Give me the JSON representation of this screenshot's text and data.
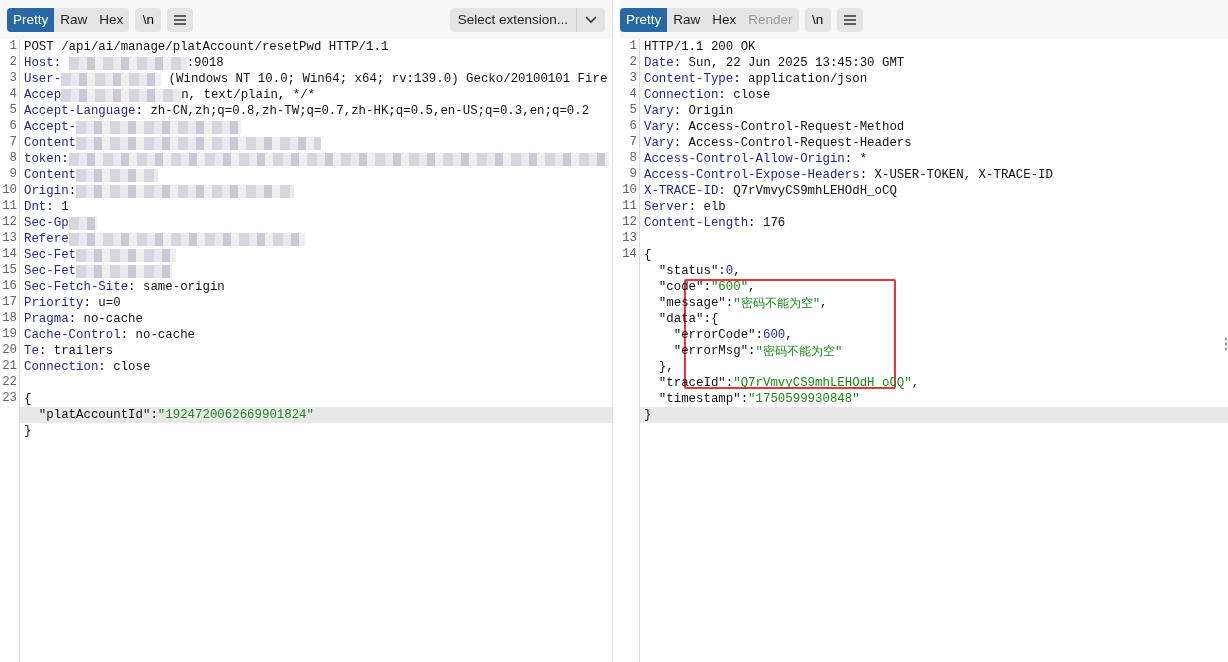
{
  "request": {
    "tabs": [
      {
        "label": "Pretty",
        "selected": true,
        "disabled": false
      },
      {
        "label": "Raw",
        "selected": false,
        "disabled": false
      },
      {
        "label": "Hex",
        "selected": false,
        "disabled": false
      }
    ],
    "newline_button": "\\n",
    "extension_select": {
      "placeholder": "Select extension..."
    },
    "lines": [
      {
        "number": "1",
        "highlighted": false,
        "parts": [
          {
            "kind": "plain",
            "text": "POST /api/ai/manage/platAccount/resetPwd HTTP/1.1"
          }
        ]
      },
      {
        "number": "2",
        "highlighted": false,
        "parts": [
          {
            "kind": "key",
            "text": "Host"
          },
          {
            "kind": "plain",
            "text": ": "
          },
          {
            "kind": "redacted"
          },
          {
            "kind": "plain",
            "text": ":9018"
          }
        ]
      },
      {
        "number": "3",
        "highlighted": false,
        "parts": [
          {
            "kind": "key",
            "text": "User-"
          },
          {
            "kind": "redacted"
          },
          {
            "kind": "plain",
            "text": " (Windows NT 10.0; Win64; x64; rv:139.0) Gecko/20100101 Fire"
          }
        ]
      },
      {
        "number": "4",
        "highlighted": false,
        "parts": [
          {
            "kind": "key",
            "text": "Accep"
          },
          {
            "kind": "redacted"
          },
          {
            "kind": "plain",
            "text": "n, text/plain, */*"
          }
        ]
      },
      {
        "number": "5",
        "highlighted": false,
        "parts": [
          {
            "kind": "key",
            "text": "Accept-Language"
          },
          {
            "kind": "plain",
            "text": ": zh-CN,zh;q=0.8,zh-TW;q=0.7,zh-HK;q=0.5,en-US;q=0.3,en;q=0.2"
          }
        ]
      },
      {
        "number": "6",
        "highlighted": false,
        "parts": [
          {
            "kind": "key",
            "text": "Accept-"
          },
          {
            "kind": "redacted"
          }
        ]
      },
      {
        "number": "7",
        "highlighted": false,
        "parts": [
          {
            "kind": "key",
            "text": "Content"
          },
          {
            "kind": "redacted"
          }
        ]
      },
      {
        "number": "8",
        "highlighted": false,
        "parts": [
          {
            "kind": "key",
            "text": "token"
          },
          {
            "kind": "plain",
            "text": ":"
          },
          {
            "kind": "redacted"
          }
        ]
      },
      {
        "number": "9",
        "highlighted": false,
        "parts": [
          {
            "kind": "key",
            "text": "Content"
          },
          {
            "kind": "redacted"
          }
        ]
      },
      {
        "number": "10",
        "highlighted": false,
        "parts": [
          {
            "kind": "key",
            "text": "Origin"
          },
          {
            "kind": "plain",
            "text": ":"
          },
          {
            "kind": "redacted"
          }
        ]
      },
      {
        "number": "11",
        "highlighted": false,
        "parts": [
          {
            "kind": "key",
            "text": "Dnt"
          },
          {
            "kind": "plain",
            "text": ": 1"
          }
        ]
      },
      {
        "number": "12",
        "highlighted": false,
        "parts": [
          {
            "kind": "key",
            "text": "Sec-Gp"
          },
          {
            "kind": "redacted"
          }
        ]
      },
      {
        "number": "13",
        "highlighted": false,
        "parts": [
          {
            "kind": "key",
            "text": "Refere"
          },
          {
            "kind": "redacted"
          }
        ]
      },
      {
        "number": "14",
        "highlighted": false,
        "parts": [
          {
            "kind": "key",
            "text": "Sec-Fet"
          },
          {
            "kind": "redacted"
          }
        ]
      },
      {
        "number": "15",
        "highlighted": false,
        "parts": [
          {
            "kind": "key",
            "text": "Sec-Fet"
          },
          {
            "kind": "redacted"
          }
        ]
      },
      {
        "number": "16",
        "highlighted": false,
        "parts": [
          {
            "kind": "key",
            "text": "Sec-Fetch-Site"
          },
          {
            "kind": "plain",
            "text": ": same-origin"
          }
        ]
      },
      {
        "number": "17",
        "highlighted": false,
        "parts": [
          {
            "kind": "key",
            "text": "Priority"
          },
          {
            "kind": "plain",
            "text": ": u=0"
          }
        ]
      },
      {
        "number": "18",
        "highlighted": false,
        "parts": [
          {
            "kind": "key",
            "text": "Pragma"
          },
          {
            "kind": "plain",
            "text": ": no-cache"
          }
        ]
      },
      {
        "number": "19",
        "highlighted": false,
        "parts": [
          {
            "kind": "key",
            "text": "Cache-Control"
          },
          {
            "kind": "plain",
            "text": ": no-cache"
          }
        ]
      },
      {
        "number": "20",
        "highlighted": false,
        "parts": [
          {
            "kind": "key",
            "text": "Te"
          },
          {
            "kind": "plain",
            "text": ": trailers"
          }
        ]
      },
      {
        "number": "21",
        "highlighted": false,
        "parts": [
          {
            "kind": "key",
            "text": "Connection"
          },
          {
            "kind": "plain",
            "text": ": close"
          }
        ]
      },
      {
        "number": "22",
        "highlighted": false
      },
      {
        "number": "23",
        "highlighted": false,
        "parts": [
          {
            "kind": "plain",
            "text": "{"
          }
        ]
      },
      {
        "highlighted": true,
        "parts": [
          {
            "kind": "plain",
            "text": "  \"platAccountId\":"
          },
          {
            "kind": "string",
            "text": "\"1924720062669901824\""
          }
        ]
      },
      {
        "highlighted": false,
        "parts": [
          {
            "kind": "plain",
            "text": "}"
          }
        ]
      }
    ]
  },
  "response": {
    "tabs": [
      {
        "label": "Pretty",
        "selected": true,
        "disabled": false
      },
      {
        "label": "Raw",
        "selected": false,
        "disabled": false
      },
      {
        "label": "Hex",
        "selected": false,
        "disabled": false
      },
      {
        "label": "Render",
        "selected": false,
        "disabled": true
      }
    ],
    "newline_button": "\\n",
    "lines": [
      {
        "number": "1",
        "highlighted": false,
        "parts": [
          {
            "kind": "plain",
            "text": "HTTP/1.1 200 OK"
          }
        ]
      },
      {
        "number": "2",
        "highlighted": false,
        "parts": [
          {
            "kind": "key",
            "text": "Date"
          },
          {
            "kind": "plain",
            "text": ": Sun, 22 Jun 2025 13:45:30 GMT"
          }
        ]
      },
      {
        "number": "3",
        "highlighted": false,
        "parts": [
          {
            "kind": "key",
            "text": "Content-Type"
          },
          {
            "kind": "plain",
            "text": ": application/json"
          }
        ]
      },
      {
        "number": "4",
        "highlighted": false,
        "parts": [
          {
            "kind": "key",
            "text": "Connection"
          },
          {
            "kind": "plain",
            "text": ": close"
          }
        ]
      },
      {
        "number": "5",
        "highlighted": false,
        "parts": [
          {
            "kind": "key",
            "text": "Vary"
          },
          {
            "kind": "plain",
            "text": ": Origin"
          }
        ]
      },
      {
        "number": "6",
        "highlighted": false,
        "parts": [
          {
            "kind": "key",
            "text": "Vary"
          },
          {
            "kind": "plain",
            "text": ": Access-Control-Request-Method"
          }
        ]
      },
      {
        "number": "7",
        "highlighted": false,
        "parts": [
          {
            "kind": "key",
            "text": "Vary"
          },
          {
            "kind": "plain",
            "text": ": Access-Control-Request-Headers"
          }
        ]
      },
      {
        "number": "8",
        "highlighted": false,
        "parts": [
          {
            "kind": "key",
            "text": "Access-Control-Allow-Origin"
          },
          {
            "kind": "plain",
            "text": ": *"
          }
        ]
      },
      {
        "number": "9",
        "highlighted": false,
        "parts": [
          {
            "kind": "key",
            "text": "Access-Control-Expose-Headers"
          },
          {
            "kind": "plain",
            "text": ": X-USER-TOKEN, X-TRACE-ID"
          }
        ]
      },
      {
        "number": "10",
        "highlighted": false,
        "parts": [
          {
            "kind": "key",
            "text": "X-TRACE-ID"
          },
          {
            "kind": "plain",
            "text": ": Q7rVmvyCS9mhLEHOdH_oCQ"
          }
        ]
      },
      {
        "number": "11",
        "highlighted": false,
        "parts": [
          {
            "kind": "key",
            "text": "Server"
          },
          {
            "kind": "plain",
            "text": ": elb"
          }
        ]
      },
      {
        "number": "12",
        "highlighted": false,
        "parts": [
          {
            "kind": "key",
            "text": "Content-Length"
          },
          {
            "kind": "plain",
            "text": ": 176"
          }
        ]
      },
      {
        "number": "13",
        "highlighted": false
      },
      {
        "number": "14",
        "highlighted": false,
        "parts": [
          {
            "kind": "plain",
            "text": "{"
          }
        ]
      },
      {
        "highlighted": false,
        "parts": [
          {
            "kind": "plain",
            "text": "  \"status\":"
          },
          {
            "kind": "number",
            "text": "0"
          },
          {
            "kind": "plain",
            "text": ","
          }
        ]
      },
      {
        "highlighted": false,
        "parts": [
          {
            "kind": "plain",
            "text": "  \"code\":"
          },
          {
            "kind": "string",
            "text": "\"600\""
          },
          {
            "kind": "plain",
            "text": ","
          }
        ]
      },
      {
        "highlighted": false,
        "parts": [
          {
            "kind": "plain",
            "text": "  \"message\":"
          },
          {
            "kind": "string",
            "text": "\"密码不能为空\""
          },
          {
            "kind": "plain",
            "text": ","
          }
        ]
      },
      {
        "highlighted": false,
        "parts": [
          {
            "kind": "plain",
            "text": "  \"data\":{"
          }
        ]
      },
      {
        "highlighted": false,
        "parts": [
          {
            "kind": "plain",
            "text": "    \"errorCode\":"
          },
          {
            "kind": "number",
            "text": "600"
          },
          {
            "kind": "plain",
            "text": ","
          }
        ]
      },
      {
        "highlighted": false,
        "parts": [
          {
            "kind": "plain",
            "text": "    \"errorMsg\":"
          },
          {
            "kind": "string",
            "text": "\"密码不能为空\""
          }
        ]
      },
      {
        "highlighted": false,
        "parts": [
          {
            "kind": "plain",
            "text": "  },"
          }
        ]
      },
      {
        "highlighted": false,
        "parts": [
          {
            "kind": "plain",
            "text": "  \"traceId\":"
          },
          {
            "kind": "string",
            "text": "\"Q7rVmvyCS9mhLEHOdH_oCQ\""
          },
          {
            "kind": "plain",
            "text": ","
          }
        ]
      },
      {
        "highlighted": false,
        "parts": [
          {
            "kind": "plain",
            "text": "  \"timestamp\":"
          },
          {
            "kind": "string",
            "text": "\"1750599930848\""
          }
        ]
      },
      {
        "highlighted": true,
        "parts": [
          {
            "kind": "plain",
            "text": "}"
          }
        ]
      }
    ]
  }
}
